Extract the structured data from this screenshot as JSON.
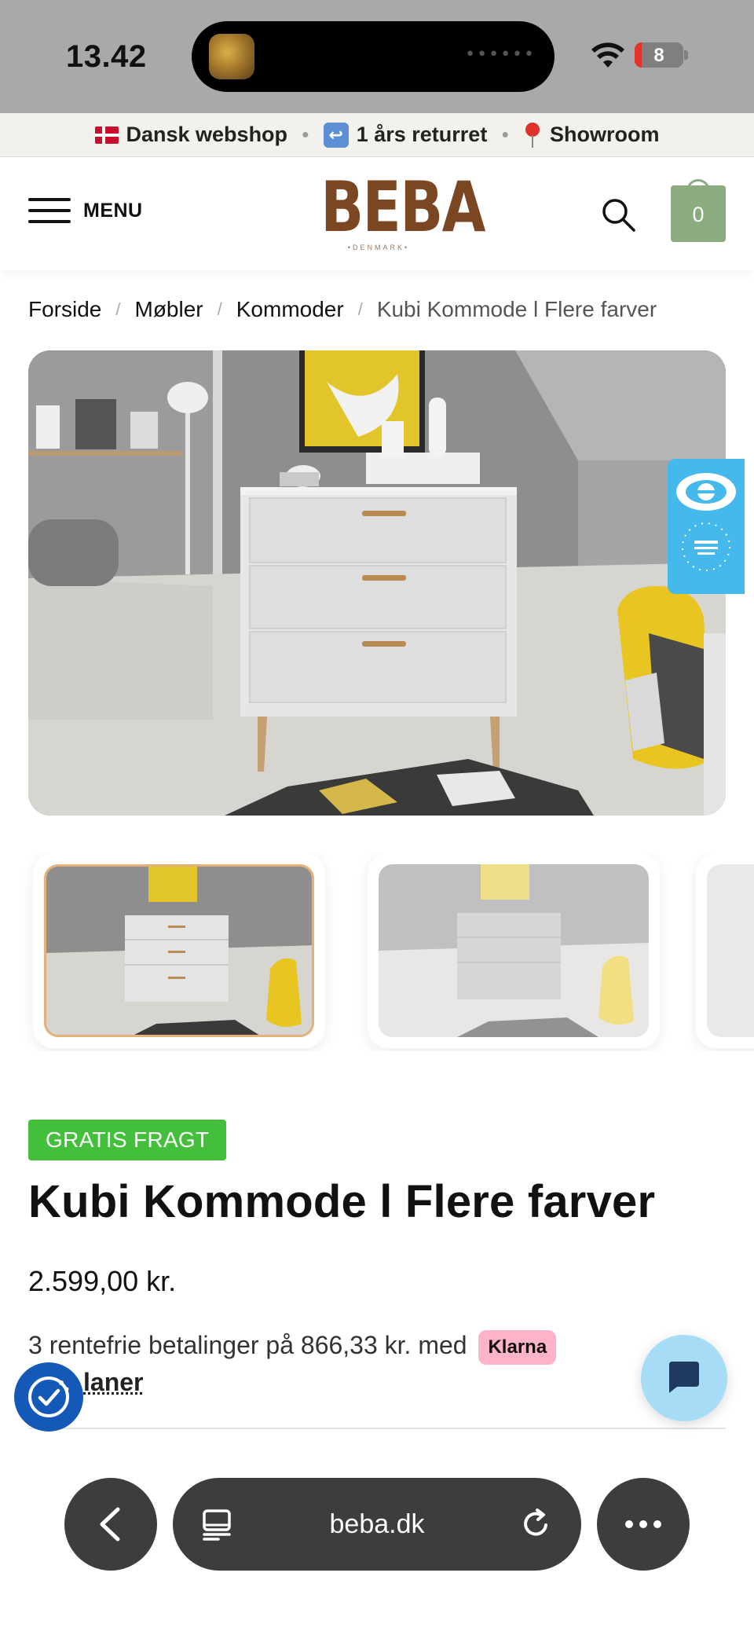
{
  "status_bar": {
    "time": "13.42",
    "battery_level": "8",
    "island_indicator": "••••••",
    "icons": [
      "wifi-icon",
      "battery-icon"
    ]
  },
  "usp_bar": {
    "items": [
      {
        "icon": "danish-flag-icon",
        "label": "Dansk webshop"
      },
      {
        "icon": "return-arrow-icon",
        "label": "1 års returret"
      },
      {
        "icon": "location-pin-icon",
        "label": "Showroom"
      }
    ]
  },
  "header": {
    "menu_label": "MENU",
    "logo_text": "BEBA",
    "logo_subtext": "•DENMARK•",
    "cart_count": "0",
    "icons": [
      "hamburger-icon",
      "search-icon",
      "cart-bag-icon"
    ]
  },
  "breadcrumb": {
    "items": [
      "Forside",
      "Møbler",
      "Kommoder"
    ],
    "current": "Kubi Kommode l Flere farver",
    "separator": "/"
  },
  "gallery": {
    "main_image_alt": "White three-drawer dresser with wooden legs in a grey room",
    "thumbnail_count": 3,
    "selected_thumbnail": 1,
    "trust_badge": "emaerket-ecommerce-europe-icon"
  },
  "product": {
    "badge": "GRATIS FRAGT",
    "title": "Kubi Kommode l Flere farver",
    "price": "2.599,00 kr.",
    "installment_text": "3 rentefrie betalinger på 866,33 kr. med",
    "klarna_label": "Klarna",
    "installment_link": "delbetalingsplaner",
    "installment_link_visible": "laner"
  },
  "browser": {
    "url": "beba.dk",
    "icons": [
      "back-chevron-icon",
      "tabs-icon",
      "reload-icon",
      "more-dots-icon"
    ]
  },
  "colors": {
    "brand_brown": "#7a4722",
    "cart_green": "#8aac7e",
    "free_shipping_green": "#43bf3c",
    "klarna_pink": "#ffb3c7",
    "chat_blue": "#a7dcf7",
    "cookie_blue": "#1458b8"
  }
}
